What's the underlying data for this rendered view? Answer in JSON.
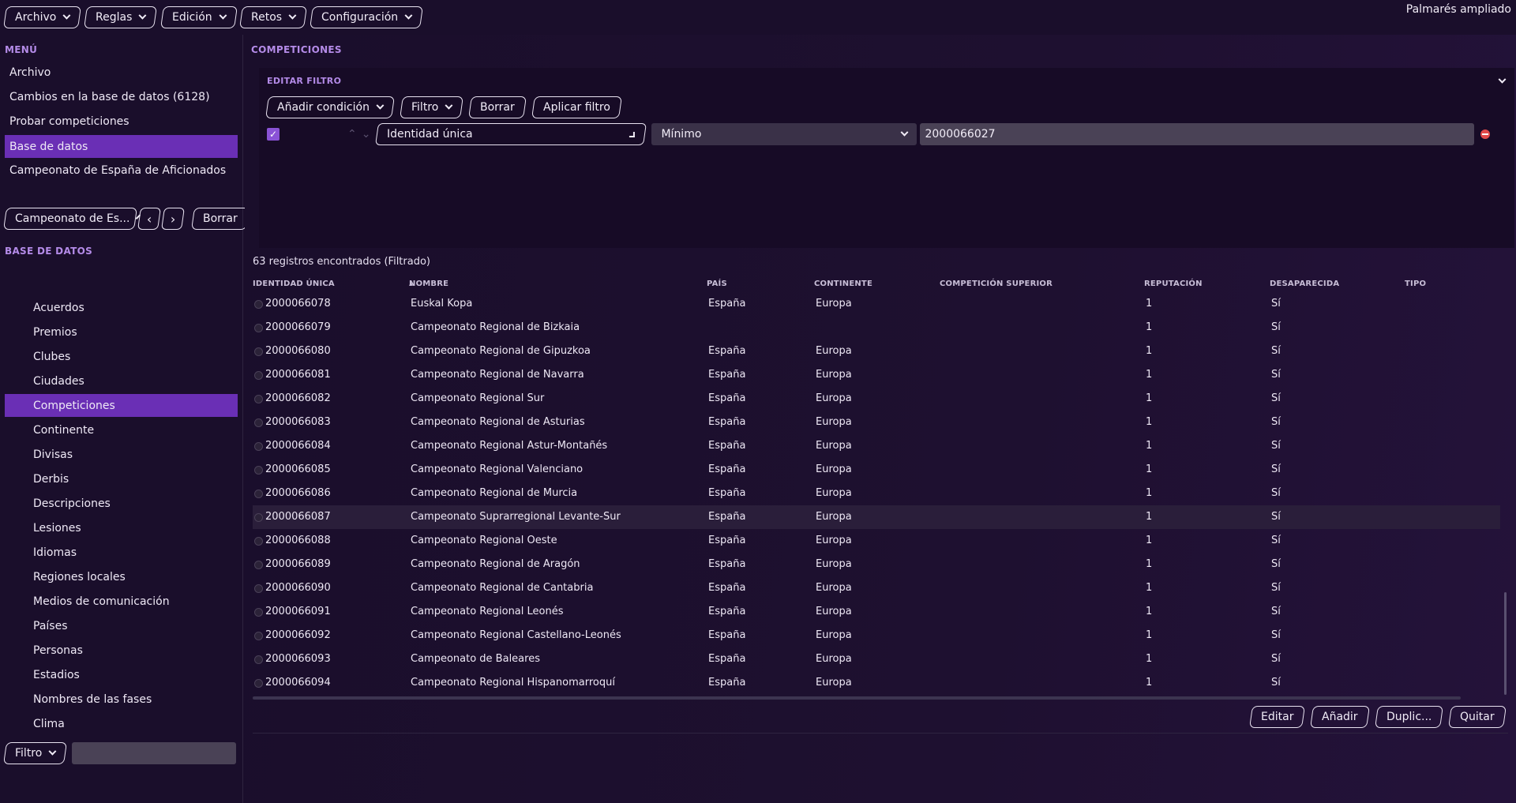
{
  "menubar": {
    "items": [
      "Archivo",
      "Reglas",
      "Edición",
      "Retos",
      "Configuración"
    ],
    "right_label": "Palmarés ampliado"
  },
  "sidebar": {
    "menu_title": "MENÚ",
    "menu_items": [
      {
        "label": "Archivo",
        "active": false
      },
      {
        "label": "Cambios en la base de datos (6128)",
        "active": false
      },
      {
        "label": "Probar competiciones",
        "active": false
      },
      {
        "label": "Base de datos",
        "active": true
      },
      {
        "label": "Campeonato de España de Aficionados",
        "active": false
      }
    ],
    "nav_selector": "Campeonato de Es...",
    "nav_prev": "‹",
    "nav_next": "›",
    "nav_clear": "Borrar",
    "db_title": "BASE DE DATOS",
    "db_items": [
      {
        "label": "Acuerdos",
        "active": false
      },
      {
        "label": "Premios",
        "active": false
      },
      {
        "label": "Clubes",
        "active": false
      },
      {
        "label": "Ciudades",
        "active": false
      },
      {
        "label": "Competiciones",
        "active": true
      },
      {
        "label": "Continente",
        "active": false
      },
      {
        "label": "Divisas",
        "active": false
      },
      {
        "label": "Derbis",
        "active": false
      },
      {
        "label": "Descripciones",
        "active": false
      },
      {
        "label": "Lesiones",
        "active": false
      },
      {
        "label": "Idiomas",
        "active": false
      },
      {
        "label": "Regiones locales",
        "active": false
      },
      {
        "label": "Medios de comunicación",
        "active": false
      },
      {
        "label": "Países",
        "active": false
      },
      {
        "label": "Personas",
        "active": false
      },
      {
        "label": "Estadios",
        "active": false
      },
      {
        "label": "Nombres de las fases",
        "active": false
      },
      {
        "label": "Clima",
        "active": false
      }
    ],
    "filter_label": "Filtro",
    "filter_search_value": ""
  },
  "main": {
    "title": "COMPETICIONES",
    "filter_panel": {
      "title": "EDITAR FILTRO",
      "buttons": {
        "add_condition": "Añadir condición",
        "filter": "Filtro",
        "clear": "Borrar",
        "apply": "Aplicar filtro"
      },
      "condition": {
        "checked": true,
        "field": "Identidad única",
        "operator": "Mínimo",
        "value": "2000066027"
      }
    },
    "records_label": "63 registros encontrados (Filtrado)",
    "columns": [
      "IDENTIDAD ÚNICA",
      "NOMBRE",
      "PAÍS",
      "CONTINENTE",
      "COMPETICIÓN SUPERIOR",
      "REPUTACIÓN",
      "DESAPARECIDA",
      "TIPO"
    ],
    "sort_column": "NOMBRE",
    "rows": [
      {
        "id": "2000066078",
        "name": "Euskal Kopa",
        "country": "España",
        "continent": "Europa",
        "parent": "",
        "rep": "1",
        "gone": "Sí",
        "type": ""
      },
      {
        "id": "2000066079",
        "name": "Campeonato Regional de Bizkaia",
        "country": "",
        "continent": "",
        "parent": "",
        "rep": "1",
        "gone": "Sí",
        "type": ""
      },
      {
        "id": "2000066080",
        "name": "Campeonato Regional de Gipuzkoa",
        "country": "España",
        "continent": "Europa",
        "parent": "",
        "rep": "1",
        "gone": "Sí",
        "type": ""
      },
      {
        "id": "2000066081",
        "name": "Campeonato Regional de Navarra",
        "country": "España",
        "continent": "Europa",
        "parent": "",
        "rep": "1",
        "gone": "Sí",
        "type": ""
      },
      {
        "id": "2000066082",
        "name": "Campeonato Regional Sur",
        "country": "España",
        "continent": "Europa",
        "parent": "",
        "rep": "1",
        "gone": "Sí",
        "type": ""
      },
      {
        "id": "2000066083",
        "name": "Campeonato Regional de Asturias",
        "country": "España",
        "continent": "Europa",
        "parent": "",
        "rep": "1",
        "gone": "Sí",
        "type": ""
      },
      {
        "id": "2000066084",
        "name": "Campeonato Regional Astur-Montañés",
        "country": "España",
        "continent": "Europa",
        "parent": "",
        "rep": "1",
        "gone": "Sí",
        "type": ""
      },
      {
        "id": "2000066085",
        "name": "Campeonato Regional Valenciano",
        "country": "España",
        "continent": "Europa",
        "parent": "",
        "rep": "1",
        "gone": "Sí",
        "type": ""
      },
      {
        "id": "2000066086",
        "name": "Campeonato Regional de Murcia",
        "country": "España",
        "continent": "Europa",
        "parent": "",
        "rep": "1",
        "gone": "Sí",
        "type": ""
      },
      {
        "id": "2000066087",
        "name": "Campeonato Suprarregional Levante-Sur",
        "country": "España",
        "continent": "Europa",
        "parent": "",
        "rep": "1",
        "gone": "Sí",
        "type": "",
        "highlight": true
      },
      {
        "id": "2000066088",
        "name": "Campeonato Regional Oeste",
        "country": "España",
        "continent": "Europa",
        "parent": "",
        "rep": "1",
        "gone": "Sí",
        "type": ""
      },
      {
        "id": "2000066089",
        "name": "Campeonato Regional de Aragón",
        "country": "España",
        "continent": "Europa",
        "parent": "",
        "rep": "1",
        "gone": "Sí",
        "type": ""
      },
      {
        "id": "2000066090",
        "name": "Campeonato Regional de Cantabria",
        "country": "España",
        "continent": "Europa",
        "parent": "",
        "rep": "1",
        "gone": "Sí",
        "type": ""
      },
      {
        "id": "2000066091",
        "name": "Campeonato Regional Leonés",
        "country": "España",
        "continent": "Europa",
        "parent": "",
        "rep": "1",
        "gone": "Sí",
        "type": ""
      },
      {
        "id": "2000066092",
        "name": "Campeonato Regional Castellano-Leonés",
        "country": "España",
        "continent": "Europa",
        "parent": "",
        "rep": "1",
        "gone": "Sí",
        "type": ""
      },
      {
        "id": "2000066093",
        "name": "Campeonato de Baleares",
        "country": "España",
        "continent": "Europa",
        "parent": "",
        "rep": "1",
        "gone": "Sí",
        "type": ""
      },
      {
        "id": "2000066094",
        "name": "Campeonato Regional Hispanomarroquí",
        "country": "España",
        "continent": "Europa",
        "parent": "",
        "rep": "1",
        "gone": "Sí",
        "type": ""
      }
    ],
    "actions": [
      "Editar",
      "Añadir",
      "Duplic...",
      "Quitar"
    ]
  },
  "icons": {
    "chevron": "chevron-down-icon",
    "check": "check-icon",
    "remove": "remove-condition-icon"
  },
  "colors": {
    "accent": "#6a2fb5",
    "title": "#b48be8",
    "background": "#1a0e2b",
    "remove": "#e34a4a"
  }
}
